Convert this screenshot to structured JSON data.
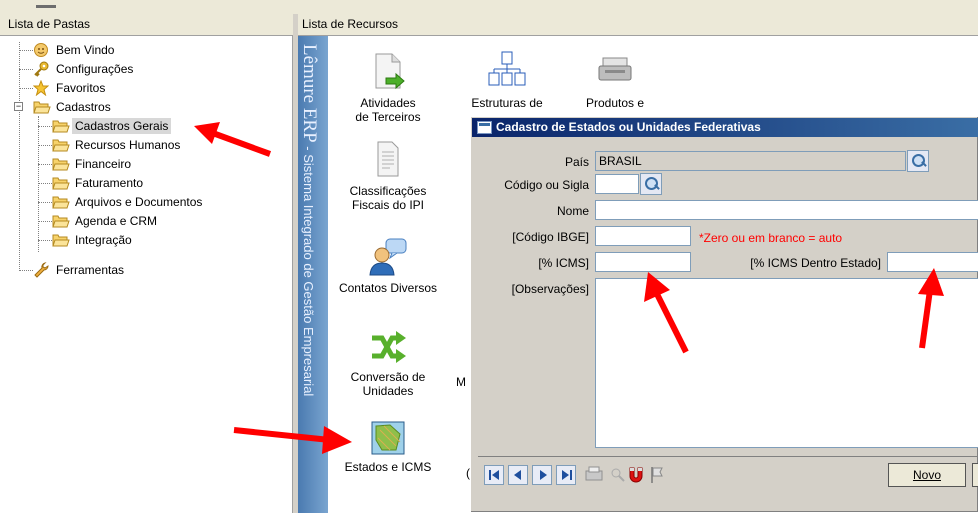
{
  "left_pane": {
    "header": "Lista de Pastas",
    "items": [
      {
        "label": "Bem Vindo",
        "icon": "welcome-icon"
      },
      {
        "label": "Configurações",
        "icon": "key-icon"
      },
      {
        "label": "Favoritos",
        "icon": "star-icon"
      },
      {
        "label": "Cadastros",
        "icon": "open-folder-icon"
      },
      {
        "label": "Cadastros Gerais",
        "icon": "folder-icon",
        "selected": true
      },
      {
        "label": "Recursos Humanos",
        "icon": "folder-icon"
      },
      {
        "label": "Financeiro",
        "icon": "folder-icon"
      },
      {
        "label": "Faturamento",
        "icon": "folder-icon"
      },
      {
        "label": "Arquivos e Documentos",
        "icon": "folder-icon"
      },
      {
        "label": "Agenda e CRM",
        "icon": "folder-icon"
      },
      {
        "label": "Integração",
        "icon": "folder-icon"
      },
      {
        "label": "Ferramentas",
        "icon": "wrench-icon"
      }
    ]
  },
  "right_pane": {
    "header": "Lista de Recursos",
    "banner_brand": "Lêmure ERP",
    "banner_text": " - Sistema Integrado de Gestão Empresarial",
    "resources": [
      {
        "label": "Atividades de Terceiros",
        "icon": "document-arrow-icon"
      },
      {
        "label": "Estruturas de",
        "icon": "org-chart-icon"
      },
      {
        "label": "Produtos e",
        "icon": "printer-icon"
      },
      {
        "label": "Classificações Fiscais do IPI",
        "icon": "document-icon"
      },
      {
        "label": "Contatos Diversos",
        "icon": "contacts-icon"
      },
      {
        "label": "Conversão de Unidades",
        "icon": "shuffle-arrows-icon"
      },
      {
        "label": "M",
        "icon": ""
      },
      {
        "label": "Estados e ICMS",
        "icon": "map-icon"
      },
      {
        "label": "(",
        "icon": ""
      }
    ]
  },
  "dialog": {
    "title": "Cadastro de Estados ou Unidades Federativas",
    "fields": {
      "pais_label": "País",
      "pais_value": "BRASIL",
      "codigo_label": "Código ou Sigla",
      "codigo_value": "",
      "nome_label": "Nome",
      "nome_value": "",
      "ibge_label": "[Código IBGE]",
      "ibge_value": "",
      "ibge_hint": "*Zero ou em branco = auto",
      "icms_label": "[% ICMS]",
      "icms_value": "",
      "icms_dentro_label": "[% ICMS Dentro Estado]",
      "icms_dentro_value": "",
      "obs_label": "[Observações]",
      "obs_value": ""
    },
    "buttons": {
      "novo": "Novo"
    }
  },
  "colors": {
    "annotation_arrow": "#ff0000",
    "title_bar_start": "#0a246a",
    "title_bar_end": "#3a6ea5",
    "hint_text": "#ff0000"
  }
}
